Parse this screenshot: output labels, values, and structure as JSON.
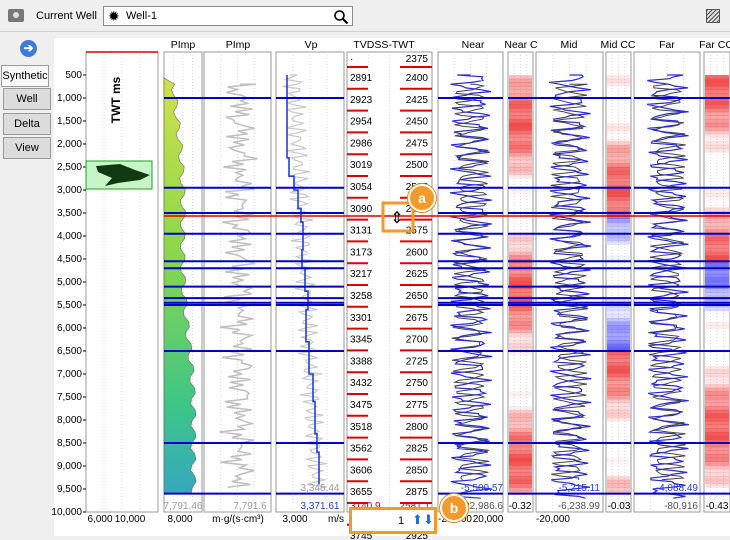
{
  "toolbar": {
    "current_well_label": "Current Well",
    "well_value": "Well-1"
  },
  "side_tabs": [
    "Synthetic",
    "Well",
    "Delta",
    "View"
  ],
  "depth_track": {
    "axis_label": "TWT ms",
    "ticks": [
      "500",
      "1,000",
      "1,500",
      "2,000",
      "2,500",
      "3,000",
      "3,500",
      "4,000",
      "4,500",
      "5,000",
      "5,500",
      "6,000",
      "6,500",
      "7,000",
      "7,500",
      "8,000",
      "8,500",
      "9,000",
      "9,500",
      "10,000"
    ],
    "bottom_ticks": [
      "6,000",
      "10,000"
    ]
  },
  "tracks": [
    {
      "name": "PImp",
      "bottom_left": "8,000",
      "bottom_right": "",
      "faint_value": "7,791.46"
    },
    {
      "name": "PImp",
      "bottom_left": "m·g/(s·cm³)",
      "bottom_right": "",
      "faint_value": "7,791.6"
    },
    {
      "name": "Vp",
      "bottom_left": "3,000",
      "bottom_right": "m/s",
      "faint_value": "3,345.44",
      "blue_value": "3,371.61"
    },
    {
      "name": "TVDSS-TWT"
    },
    {
      "name": "Near",
      "blue_value": "-5,500.57",
      "gray_value": "-22,986.6",
      "bottom_left": "-20,000",
      "bottom_right": "20,000"
    },
    {
      "name": "Near C",
      "bottom_left": "-0.32"
    },
    {
      "name": "Mid",
      "blue_value": "-5,215.11",
      "gray_value": "-6,238.99",
      "bottom_left": "-20,000"
    },
    {
      "name": "Mid CC",
      "bottom_left": "-0.03"
    },
    {
      "name": "Far",
      "blue_value": "-4,088.49",
      "gray_value": "-80,916",
      "bottom_left": ""
    },
    {
      "name": "Far CC",
      "bottom_left": "-0.43"
    }
  ],
  "tvdss": {
    "top_left": "·",
    "top_right": "2375",
    "rows": [
      [
        "2891",
        "2400"
      ],
      [
        "2923",
        "2425"
      ],
      [
        "2954",
        "2450"
      ],
      [
        "2986",
        "2475"
      ],
      [
        "3019",
        "2500"
      ],
      [
        "3054",
        "2525"
      ],
      [
        "3090",
        "2550"
      ],
      [
        "3131",
        "2575"
      ],
      [
        "3173",
        "2600"
      ],
      [
        "3217",
        "2625"
      ],
      [
        "3258",
        "2650"
      ],
      [
        "3301",
        "2675"
      ],
      [
        "3345",
        "2700"
      ],
      [
        "3388",
        "2725"
      ],
      [
        "3432",
        "2750"
      ],
      [
        "3475",
        "2775"
      ],
      [
        "3518",
        "2800"
      ],
      [
        "3562",
        "2825"
      ],
      [
        "3606",
        "2850"
      ],
      [
        "3655",
        "2875"
      ],
      [
        "3701",
        "2900"
      ],
      [
        "3745",
        "2925"
      ]
    ],
    "bottom_left": "3140.9",
    "bottom_right": "2581.1"
  },
  "stepper": {
    "value": "1"
  },
  "callouts": {
    "a": "a",
    "b": "b"
  },
  "colors": {
    "horizon_blue": "#0000c8",
    "cursor_red": "#e00000",
    "callout_orange": "#f39a2b",
    "corr_red": "#f04a4a",
    "corr_blue": "#5a5aff"
  }
}
